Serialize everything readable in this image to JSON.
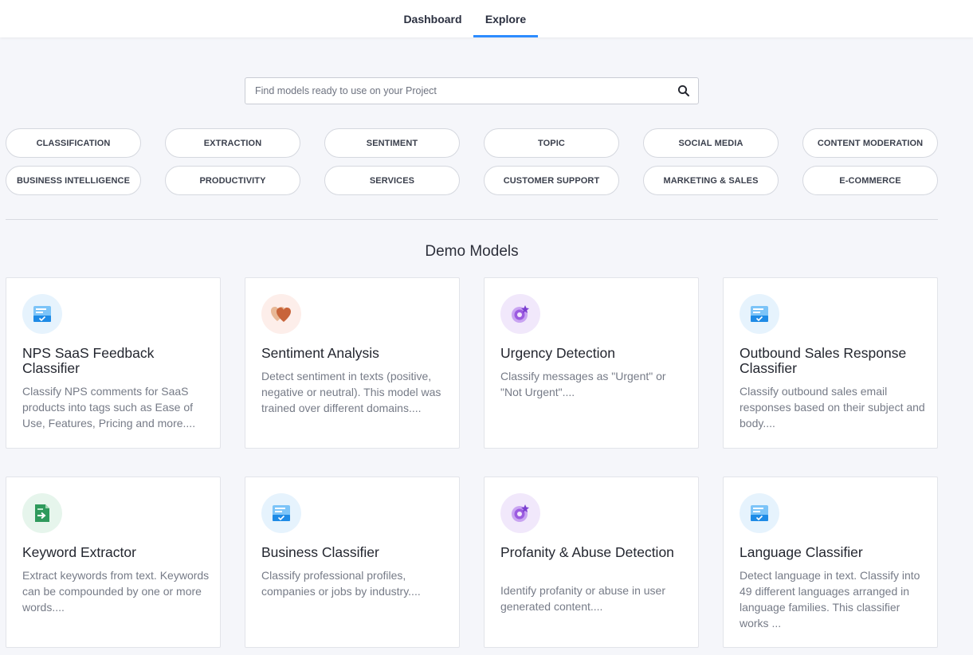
{
  "nav": {
    "tabs": [
      {
        "label": "Dashboard",
        "active": false
      },
      {
        "label": "Explore",
        "active": true
      }
    ],
    "accent_color": "#2d8cff"
  },
  "search": {
    "placeholder": "Find models ready to use on your Project",
    "value": "",
    "icon": "search-icon"
  },
  "categories": [
    "CLASSIFICATION",
    "EXTRACTION",
    "SENTIMENT",
    "TOPIC",
    "SOCIAL MEDIA",
    "CONTENT MODERATION",
    "BUSINESS INTELLIGENCE",
    "PRODUCTIVITY",
    "SERVICES",
    "CUSTOMER SUPPORT",
    "MARKETING & SALES",
    "E-COMMERCE"
  ],
  "section_title": "Demo Models",
  "models": [
    {
      "title": "NPS SaaS Feedback Classifier",
      "description": "Classify NPS comments for SaaS products into tags such as Ease of Use, Features, Pricing and more....",
      "icon": "classifier-icon"
    },
    {
      "title": "Sentiment Analysis",
      "description": "Detect sentiment in texts (positive, negative or neutral). This model was trained over different domains....",
      "icon": "hearts-icon"
    },
    {
      "title": "Urgency Detection",
      "description": "Classify messages as \"Urgent\" or \"Not Urgent\"....",
      "icon": "target-icon"
    },
    {
      "title": "Outbound Sales Response Classifier",
      "description": "Classify outbound sales email responses based on their subject and body....",
      "icon": "classifier-icon"
    },
    {
      "title": "Keyword Extractor",
      "description": "Extract keywords from text. Keywords can be compounded by one or more words....",
      "icon": "extractor-icon"
    },
    {
      "title": "Business Classifier",
      "description": "Classify professional profiles, companies or jobs by industry....",
      "icon": "classifier-icon"
    },
    {
      "title": "Profanity & Abuse Detection",
      "description": "Identify profanity or abuse in user generated content....",
      "icon": "target-icon"
    },
    {
      "title": "Language Classifier",
      "description": "Detect language in text. Classify into 49 different languages arranged in language families. This classifier works ...",
      "icon": "classifier-icon"
    }
  ]
}
